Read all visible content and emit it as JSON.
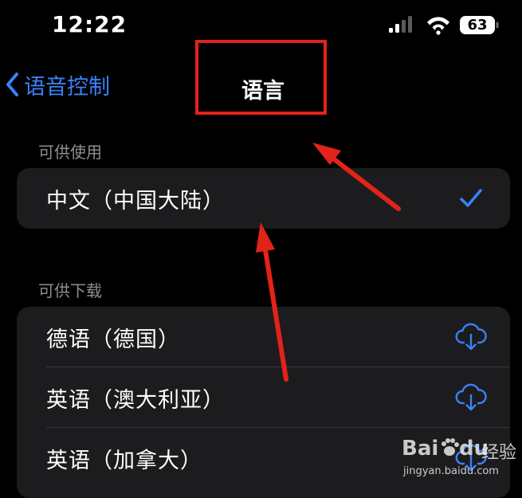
{
  "status_bar": {
    "time": "12:22",
    "battery": "63",
    "icons": [
      "signal-icon",
      "wifi-icon",
      "battery-icon"
    ]
  },
  "nav": {
    "back_label": "语音控制",
    "title": "语言"
  },
  "sections": {
    "available": {
      "header": "可供使用",
      "items": [
        {
          "label": "中文（中国大陆）",
          "accessory": "checkmark-icon"
        }
      ]
    },
    "downloadable": {
      "header": "可供下载",
      "items": [
        {
          "label": "德语（德国）",
          "accessory": "cloud-download-icon"
        },
        {
          "label": "英语（澳大利亚）",
          "accessory": "cloud-download-icon"
        },
        {
          "label": "英语（加拿大）",
          "accessory": "cloud-download-icon"
        }
      ]
    }
  },
  "watermark": {
    "brand": "Bai",
    "brand_suffix": "du",
    "suffix": "经验",
    "url": "jingyan.baidu.com"
  },
  "colors": {
    "accent": "#3a82f7",
    "background": "#000000",
    "group_background": "#1c1c1e",
    "annotation": "#e2231a"
  }
}
